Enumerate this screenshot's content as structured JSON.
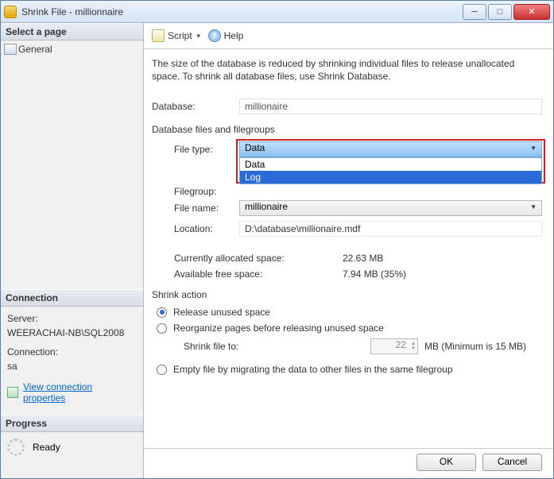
{
  "window": {
    "title": "Shrink File - millionnaire"
  },
  "left": {
    "select_page": "Select a page",
    "general": "General",
    "connection_hdr": "Connection",
    "server_lbl": "Server:",
    "server_val": "WEERACHAI-NB\\SQL2008",
    "conn_lbl": "Connection:",
    "conn_val": "sa",
    "view_props": "View connection properties",
    "progress_hdr": "Progress",
    "progress_state": "Ready"
  },
  "toolbar": {
    "script": "Script",
    "help": "Help"
  },
  "main": {
    "intro": "The size of the database is reduced by shrinking individual files to release unallocated space. To shrink all database files, use Shrink Database.",
    "database_lbl": "Database:",
    "database_val": "millionaire",
    "files_group": "Database files and filegroups",
    "filetype_lbl": "File type:",
    "filetype_val": "Data",
    "filetype_options": {
      "opt1": "Data",
      "opt2": "Log"
    },
    "filegroup_lbl": "Filegroup:",
    "filename_lbl": "File name:",
    "filename_val": "millionaire",
    "location_lbl": "Location:",
    "location_val": "D:\\database\\millionaire.mdf",
    "alloc_lbl": "Currently allocated space:",
    "alloc_val": "22.63 MB",
    "free_lbl": "Available free space:",
    "free_val": "7.94 MB (35%)",
    "shrink_action": "Shrink action",
    "opt_release": "Release unused space",
    "opt_reorg": "Reorganize pages before releasing unused space",
    "shrink_to_lbl": "Shrink file to:",
    "shrink_to_val": "22",
    "shrink_to_hint": "MB (Minimum is 15 MB)",
    "opt_empty": "Empty file by migrating the data to other files in the same filegroup"
  },
  "buttons": {
    "ok": "OK",
    "cancel": "Cancel"
  }
}
